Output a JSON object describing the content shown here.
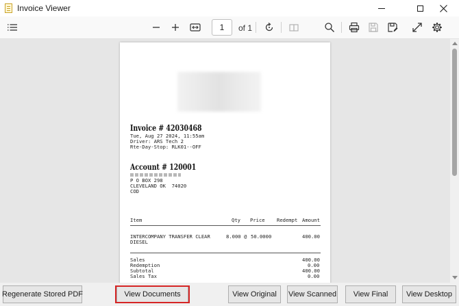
{
  "window": {
    "title": "Invoice Viewer"
  },
  "toolbar": {
    "page_number": "1",
    "page_of": "of 1",
    "icons": [
      "list-icon",
      "zoom-out-icon",
      "zoom-in-icon",
      "fit-width-icon",
      "rotate-icon",
      "two-page-icon",
      "search-icon",
      "print-icon",
      "save-icon",
      "save-as-icon",
      "fullscreen-icon",
      "settings-icon"
    ]
  },
  "document": {
    "invoice_heading": "Invoice # 42030468",
    "meta_lines": [
      "Tue, Aug 27 2024, 11:55am",
      "Driver: ARS Tech 2",
      "Rte-Day-Stop: RLK01--OFF"
    ],
    "account_heading": "Account # 120001",
    "address_lines": [
      "P O BOX 298",
      "CLEVELAND OK  74020",
      "COD"
    ],
    "columns": {
      "item": "Item",
      "qty": "Qty",
      "price": "Price",
      "redempt": "Redempt",
      "amount": "Amount"
    },
    "line_item": {
      "desc1": "INTERCOMPANY TRANSFER CLEAR",
      "desc2": "DIESEL",
      "qty": "8.000 @",
      "price": "50.0000",
      "amount": "400.00"
    },
    "totals": [
      {
        "label": "Sales",
        "value": "400.00"
      },
      {
        "label": "Redemption",
        "value": "0.00"
      },
      {
        "label": "Subtotal",
        "value": "400.00"
      },
      {
        "label": "Sales Tax",
        "value": "0.00"
      }
    ]
  },
  "buttons": {
    "regenerate": "Regenerate Stored PDF",
    "view_documents": "View Documents",
    "view_original": "View Original",
    "view_scanned": "View Scanned",
    "view_final": "View Final",
    "view_desktop": "View Desktop"
  },
  "colors": {
    "highlight": "#d62525",
    "viewport_bg": "#e6e6e6"
  }
}
